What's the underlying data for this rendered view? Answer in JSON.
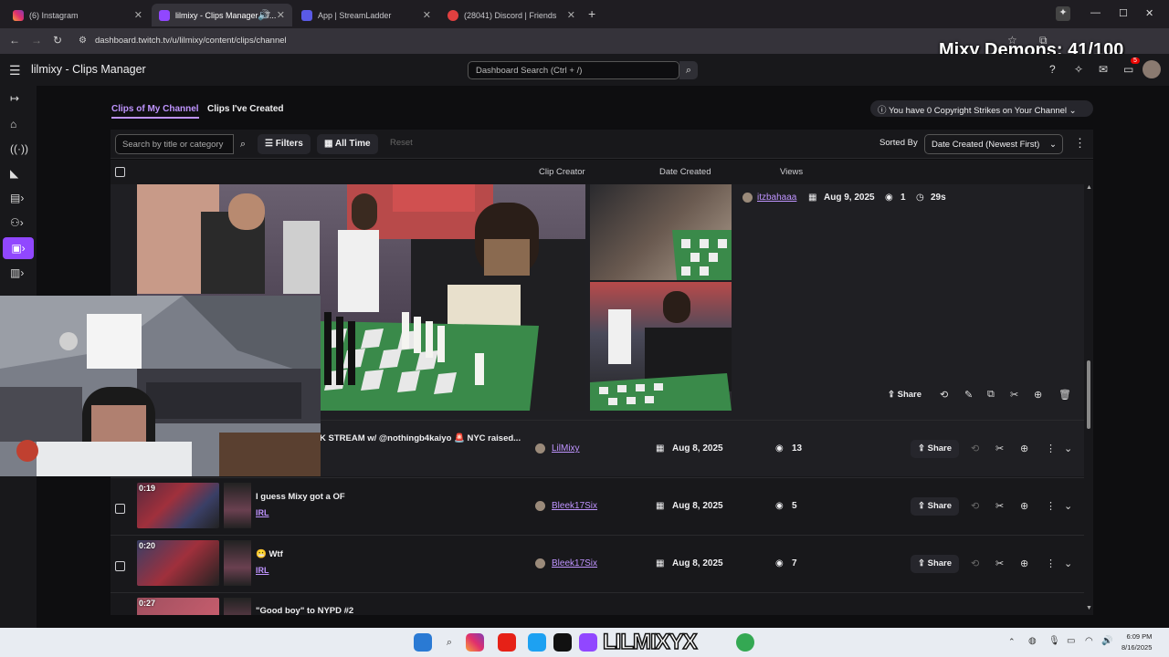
{
  "browser": {
    "tabs": [
      {
        "title": "(6) Instagram"
      },
      {
        "title": "lilmixy - Clips Manager - T..."
      },
      {
        "title": "App | StreamLadder"
      },
      {
        "title": "(28041) Discord | Friends"
      }
    ],
    "url": "dashboard.twitch.tv/u/lilmixy/content/clips/channel"
  },
  "overlay": {
    "text": "Mixy Demons: 41/100"
  },
  "header": {
    "title": "lilmixy - Clips Manager",
    "search_placeholder": "Dashboard Search (Ctrl + /)",
    "notification_count": "5"
  },
  "tabs": {
    "mine": "Clips of My Channel",
    "created": "Clips I've Created"
  },
  "strikes": {
    "text": "You have 0 Copyright Strikes on Your Channel"
  },
  "toolbar": {
    "search_placeholder": "Search by title or category",
    "filters": "Filters",
    "time": "All Time",
    "reset": "Reset",
    "sorted_by": "Sorted By",
    "sort_value": "Date Created (Newest First)"
  },
  "columns": {
    "creator": "Clip Creator",
    "date": "Date Created",
    "views": "Views"
  },
  "expanded_clip": {
    "creator": "itzbahaaa",
    "date": "Aug 9, 2025",
    "views": "1",
    "duration": "29s",
    "share": "Share"
  },
  "rows": [
    {
      "duration": "",
      "title": "K STREAM w/ @nothingb4kaiyo 🚨 NYC raised...",
      "category": "",
      "creator": "LilMixy",
      "date": "Aug 8, 2025",
      "views": "13",
      "share": "Share"
    },
    {
      "duration": "0:19",
      "title": "I guess Mixy got a OF",
      "category": "IRL",
      "creator": "Bleek17Six",
      "date": "Aug 8, 2025",
      "views": "5",
      "share": "Share"
    },
    {
      "duration": "0:20",
      "title": "😬 Wtf",
      "category": "IRL",
      "creator": "Bleek17Six",
      "date": "Aug 8, 2025",
      "views": "7",
      "share": "Share"
    },
    {
      "duration": "0:27",
      "title": "\"Good boy\" to NYPD #2",
      "category": "",
      "creator": "",
      "date": "",
      "views": "",
      "share": ""
    }
  ],
  "taskbar": {
    "brand": "LILMIXYX",
    "time": "6:09 PM",
    "date": "8/16/2025"
  },
  "colors": {
    "accent": "#9147ff",
    "link": "#bf94ff",
    "bg": "#0e0e10"
  }
}
